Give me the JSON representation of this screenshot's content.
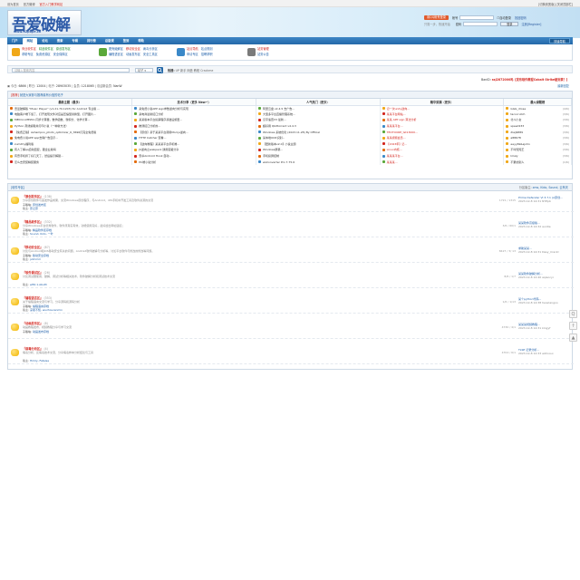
{
  "topstrip": {
    "left": [
      "设为首页",
      "官方微博",
      "官方入门教学网站"
    ],
    "right": "[切换到宽版] [关闭顶部栏]"
  },
  "logo": {
    "text": "吾爱破解",
    "url": "www.52pojie.cn"
  },
  "login": {
    "qq": "用QQ帐号登录",
    "sub": "只需一步，快速开始",
    "user_label": "帐号",
    "pass_label": "密码",
    "auto": "自动登录",
    "find": "找回密码",
    "login_btn": "登录",
    "register": "注册[Register]"
  },
  "nav": {
    "items": [
      "门户",
      "网站",
      "论坛",
      "搜索",
      "专辑",
      "排行榜",
      "总版规",
      "签到",
      "帮助"
    ],
    "active": 1,
    "right": [
      "快速导航"
    ]
  },
  "subnav": {
    "groups": [
      {
        "color": "#f0a818",
        "lines": [
          [
            "商业软件区",
            "精品软件区",
            "原创发布区"
          ],
          [
            "求助专区",
            "免费资源区",
            "安全保障区"
          ]
        ]
      },
      {
        "color": "#5aa83a",
        "lines": [
          [
            "脱壳破解区",
            "移动安全区",
            "病毒分析区"
          ],
          [
            "编程语言区",
            "动画发布区",
            "安全工具区"
          ]
        ]
      },
      {
        "color": "#3a88c8",
        "lines": [
          [
            "站点导航",
            "站点规则"
          ],
          [
            "申请专区",
            "招聘求职"
          ]
        ]
      },
      {
        "color": "#7a7a7a",
        "lines": [
          [
            "站务管理"
          ],
          [
            "站务公告"
          ]
        ]
      }
    ]
  },
  "search": {
    "placeholder": "请输入搜索内容",
    "select": "帖子",
    "hot_label": "热搜:",
    "hot": [
      "UP",
      "新手",
      "网盘",
      "教程",
      "Crackme"
    ]
  },
  "notice": {
    "label": "BanID:",
    "text": "ssj2872000吗【发布软件教程Cobalt Strike被封禁？】"
  },
  "stats": {
    "today_label": "今日:",
    "today": "6866",
    "yesterday_label": "昨日:",
    "yesterday": "12004",
    "posts_label": "帖子:",
    "posts": "28903035",
    "members_label": "会员:",
    "members": "1218065",
    "newest_label": "欢迎新会员:",
    "newest": "NanW",
    "right": "最新回复"
  },
  "recommend": {
    "bar_left": "[推荐]",
    "bar_text": "就是大家参与推荐最有价值的帖子",
    "headers": [
      "最新主题（最多）",
      "技术分享（更多 New~）",
      "人气热门（更多）",
      "精华采撷（更多）",
      "最火绿题榜"
    ],
    "col1": [
      "吾爱破解版 \"Music Player\" (v1.21.70.1203) for Android 专业版 ...",
      "电脑客户端下载了，打开发现文件对应是压缩型替换型，打开图片...",
      "MEIOon.MEWin 同步计算器，数学函数、微积分、化学计算...",
      "Python 离线编辑并打印小说（一种新方法）",
      "【免费正版】Ashampoo_photo_optimizer_6_3696打完全免费版",
      "免电费小说APP app去除广告显示...",
      "zumXhy福利版",
      "有人了解qq自动回复，跟企业版吗",
      "有奇手机拆了好几天了，然后提示解锁...",
      "怎么去安装精装服务"
    ],
    "col2": [
      "某免费小说APP sign参数逆向分析与实现",
      "某电商最新接口分析",
      "某某版本平台投票程序基础设施更...",
      "推测接口分析的...",
      "【原创】基于某某平台调用Mod.js逆向...",
      "HTTP Catcher 查看...",
      "【逆向教程】某某某平台手机端...",
      "JS逆向之webpack 通用思路分享",
      "安卓Android Hook 自动...",
      "PC端小说分析"
    ],
    "col3": [
      "阿里云盘 v2.4.5 去广告...",
      "大型多平台直播管理系统...",
      "汉字速查V3 最新...",
      "超好用 Qbittorrent v4.4.3",
      "Windows 系统优化 (2023.11.28) By Official",
      "某本地OCR识别...",
      "【更新版本v2.0】小说主题",
      "Windows屏幕...",
      "手机投屏控制",
      "wsConverter Pro 7.75.6"
    ],
    "col4": [
      "记一次unity逆向...",
      "某某平台网站...",
      "某某 APP sign 算法分析",
      "某某某平台...",
      "TEOTOURE_tst13000...",
      "某某视频会员...",
      "【2023年】记...",
      "Linux内核...",
      "某某某平台...",
      "某某某..."
    ],
    "col5": [
      [
        "GGG_drose",
        "(4/6)"
      ],
      [
        "tacocrutch",
        "(3/6)"
      ],
      [
        "北斗小女",
        "(3/6)"
      ],
      [
        "speed233",
        "(3/6)"
      ],
      [
        "dlwj9889",
        "(3/6)"
      ],
      [
        "a88678",
        "(3/6)"
      ],
      [
        "eeyy69&sjohn",
        "(3/6)"
      ],
      [
        "不叫知知王",
        "(3/6)"
      ],
      [
        "lmaly",
        "(3/6)"
      ],
      [
        "不累的别人",
        "(1/6)"
      ]
    ]
  },
  "forum": {
    "bar": "[软件专区]",
    "mods_label": "分区版主:",
    "mods": "zmo, Kido, Sound, 云有天",
    "rows": [
      {
        "title": "『原创发布区』",
        "count_today": "(138)",
        "desc": "分享原创软件与首发作品成果，交流Windows原创程序，与Android、iOS手机中开发工具及软件资源的交流",
        "sub_label": "子版块:",
        "sub": "原创发布区",
        "mod_label": "版主:",
        "mod": "原之原",
        "stats": "1721 / 1315",
        "last_title": "Prime Defender VI 3.7.1 (A原创...",
        "last_time": "2023-12-8 14:31 NYEpb"
      },
      {
        "title": "『精品软件区』",
        "count_today": "(332)",
        "desc": "分享Windows平台优秀软件，软件须真实有效，功能使用完好，最好给出网址链接；",
        "sub_label": "子版块:",
        "sub": "精品软件区存档",
        "mod_label": "版主:",
        "mod": "Sound, Kido, 一叶",
        "stats": "3/6 / 60/1",
        "last_title": "某某软件高级版...",
        "last_time": "2023-12-8 14:32 auntie"
      },
      {
        "title": "『移动安全区』",
        "count_today": "(67)",
        "desc": "讨论与Android和iOS移动安全有关的问题，Android软件破解与分析等，讨论平台软件与修改的修改等问题。",
        "sub_label": "子版块:",
        "sub": "移动安全存档",
        "mod_label": "版主:",
        "mod": "jvlmmm",
        "stats": "8427 / 3/ 13",
        "last_title": "求助某某...",
        "last_time": "2023-12-8 14:31 Dasy_Crackl"
      },
      {
        "title": "『软件调试区』",
        "count_today": "(26)",
        "desc": "讨论调试器使用、破解、调试分析等相关技术，软件破解分析和调试技术交流",
        "sub_label": "",
        "sub": "",
        "mod_label": "版主:",
        "mod": "w82.1.Abuth",
        "stats": "8/6 / 1/7",
        "last_title": "某某软件破解分析...",
        "last_time": "2023-12-8 12:40 aqiaocyi"
      },
      {
        "title": "『编程语言区』",
        "count_today": "(353)",
        "desc": "关于编程语言交流与学习，分享源码和源码分析",
        "sub_label": "子版块:",
        "sub": "编程语言存档",
        "mod_label": "版主:",
        "mod": "凉夏不知, wuzhourenmin",
        "stats": "1/6 / 1/13",
        "last_title": "某个python代码...",
        "last_time": "2023-12-8 14:38 herwiangoo"
      },
      {
        "title": "『动画发布区』",
        "count_today": "(6)",
        "desc": "动画教程发布，视频教程分享与学习交流",
        "sub_label": "子版块:",
        "sub": "动画发布存档",
        "mod_label": "",
        "mod": "",
        "stats": "4730 / 4/1",
        "last_title": "某某某视频教程...",
        "last_time": "2023-12-8 14:31 kingyf"
      },
      {
        "title": "『病毒分析区』",
        "count_today": "(4)",
        "desc": "病毒分析、反病毒技术交流，分享病毒样本分析结论与工具",
        "sub_label": "",
        "sub": "",
        "mod_label": "版主:",
        "mod": "Hmily, Fateise",
        "stats": "4704 / 6/1",
        "last_title": "TLSE 记录分析...",
        "last_time": "2023-12-8 12:33 wzhooui"
      }
    ]
  },
  "side": [
    "Q",
    "↑",
    "▲"
  ]
}
